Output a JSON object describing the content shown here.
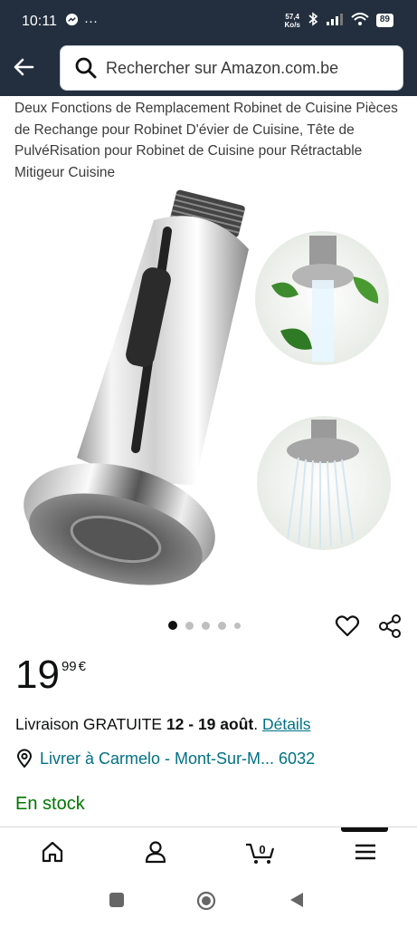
{
  "status": {
    "time": "10:11",
    "net_speed_value": "57,4",
    "net_speed_unit": "Ko/s",
    "battery": "89"
  },
  "search": {
    "placeholder": "Rechercher sur Amazon.com.be"
  },
  "product": {
    "title": "Deux Fonctions de Remplacement Robinet de Cuisine Pièces de Rechange pour Robinet D'évier de Cuisine, Tête de PulvéRisation pour Robinet de Cuisine pour Rétractable Mitigeur Cuisine",
    "price_whole": "19",
    "price_fraction": "99",
    "currency": "€",
    "image_count": 5,
    "image_index": 1
  },
  "delivery": {
    "prefix": "Livraison GRATUITE ",
    "dates": "12 - 19 août",
    "suffix": ". ",
    "details_link": "Détails"
  },
  "location": {
    "text": "Livrer à Carmelo - Mont-Sur-M... 6032"
  },
  "stock": {
    "text": "En stock"
  },
  "bottom_nav": {
    "cart_count": "0",
    "items": [
      "home-icon",
      "account-icon",
      "cart-icon",
      "menu-icon"
    ]
  },
  "colors": {
    "header_bg": "#232f3e",
    "link": "#007185",
    "in_stock": "#007600"
  }
}
